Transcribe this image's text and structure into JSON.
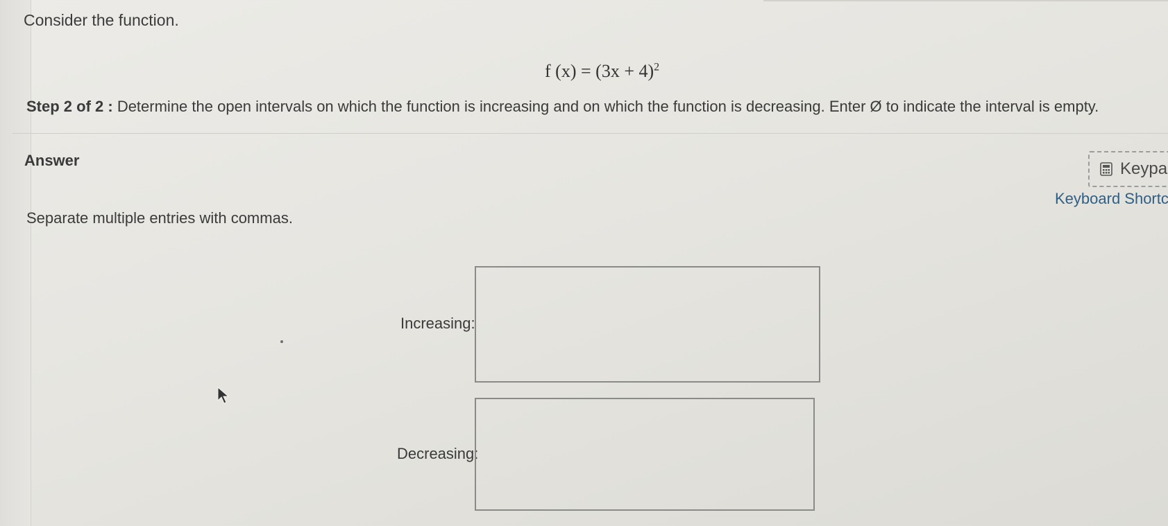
{
  "question": {
    "intro": "Consider the function.",
    "formula": {
      "lhs": "f (x)",
      "eq": "=",
      "rhs": "(3x + 4)",
      "exponent": "2"
    },
    "step_label": "Step 2 of 2 :",
    "step_text": "Determine the open intervals on which the function is increasing and on which the function is decreasing. Enter Ø to indicate the interval is empty."
  },
  "answer": {
    "heading": "Answer",
    "instruction": "Separate multiple entries with commas.",
    "keypad_label": "Keypa",
    "keyboard_shortcuts_label": "Keyboard Shortc",
    "fields": {
      "increasing_label": "Increasing:",
      "increasing_value": "",
      "decreasing_label": "Decreasing:",
      "decreasing_value": ""
    }
  },
  "icons": {
    "keypad": "calculator-icon",
    "cursor": "mouse-pointer-icon"
  },
  "colors": {
    "link": "#2e5f86",
    "text": "#3a3a3a",
    "box_border": "#8a8a88"
  }
}
